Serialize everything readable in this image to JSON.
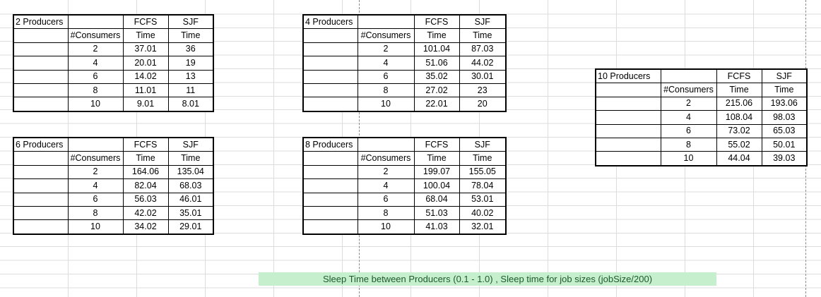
{
  "tables": {
    "p2": {
      "title": "2 Producers",
      "col1": "FCFS",
      "col2": "SJF",
      "sub0": "#Consumers",
      "sub1": "Time",
      "sub2": "Time",
      "rows": [
        {
          "c": "2",
          "f": "37.01",
          "s": "36"
        },
        {
          "c": "4",
          "f": "20.01",
          "s": "19"
        },
        {
          "c": "6",
          "f": "14.02",
          "s": "13"
        },
        {
          "c": "8",
          "f": "11.01",
          "s": "11"
        },
        {
          "c": "10",
          "f": "9.01",
          "s": "8.01"
        }
      ]
    },
    "p4": {
      "title": "4 Producers",
      "col1": "FCFS",
      "col2": "SJF",
      "sub0": "#Consumers",
      "sub1": "Time",
      "sub2": "Time",
      "rows": [
        {
          "c": "2",
          "f": "101.04",
          "s": "87.03"
        },
        {
          "c": "4",
          "f": "51.06",
          "s": "44.02"
        },
        {
          "c": "6",
          "f": "35.02",
          "s": "30.01"
        },
        {
          "c": "8",
          "f": "27.02",
          "s": "23"
        },
        {
          "c": "10",
          "f": "22.01",
          "s": "20"
        }
      ]
    },
    "p6": {
      "title": "6 Producers",
      "col1": "FCFS",
      "col2": "SJF",
      "sub0": "#Consumers",
      "sub1": "Time",
      "sub2": "Time",
      "rows": [
        {
          "c": "2",
          "f": "164.06",
          "s": "135.04"
        },
        {
          "c": "4",
          "f": "82.04",
          "s": "68.03"
        },
        {
          "c": "6",
          "f": "56.03",
          "s": "46.01"
        },
        {
          "c": "8",
          "f": "42.02",
          "s": "35.01"
        },
        {
          "c": "10",
          "f": "34.02",
          "s": "29.01"
        }
      ]
    },
    "p8": {
      "title": "8 Producers",
      "col1": "FCFS",
      "col2": "SJF",
      "sub0": "#Consumers",
      "sub1": "Time",
      "sub2": "Time",
      "rows": [
        {
          "c": "2",
          "f": "199.07",
          "s": "155.05"
        },
        {
          "c": "4",
          "f": "100.04",
          "s": "78.04"
        },
        {
          "c": "6",
          "f": "68.04",
          "s": "53.01"
        },
        {
          "c": "8",
          "f": "51.03",
          "s": "40.02"
        },
        {
          "c": "10",
          "f": "41.03",
          "s": "32.01"
        }
      ]
    },
    "p10": {
      "title": "10 Producers",
      "col1": "FCFS",
      "col2": "SJF",
      "sub0": "#Consumers",
      "sub1": "Time",
      "sub2": "Time",
      "rows": [
        {
          "c": "2",
          "f": "215.06",
          "s": "193.06"
        },
        {
          "c": "4",
          "f": "108.04",
          "s": "98.03"
        },
        {
          "c": "6",
          "f": "73.02",
          "s": "65.03"
        },
        {
          "c": "8",
          "f": "55.02",
          "s": "50.01"
        },
        {
          "c": "10",
          "f": "44.04",
          "s": "39.03"
        }
      ]
    }
  },
  "banner": "Sleep Time between Producers (0.1 - 1.0) , Sleep time for job sizes (jobSize/200)",
  "colors": {
    "banner_bg": "#c6efce",
    "banner_text": "#1d5a2b",
    "grid": "#dcdcdc"
  }
}
